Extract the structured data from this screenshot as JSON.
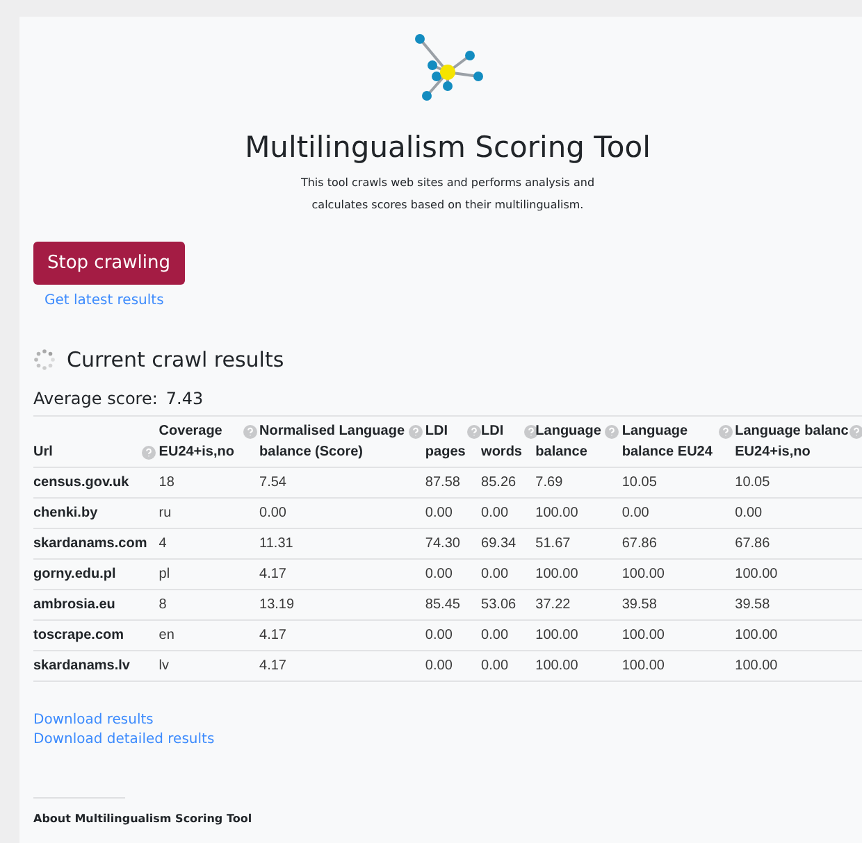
{
  "header": {
    "title": "Multilingualism Scoring Tool",
    "description_lines": [
      "This tool crawls web sites and performs analysis and",
      "calculates scores based on their multilingualism."
    ]
  },
  "stop_button": "Stop crawling",
  "latest_link": "Get latest results",
  "results": {
    "title": "Current crawl results",
    "loading": true,
    "average_label": "Average score:",
    "average_value": "7.43",
    "columns": [
      {
        "lines": [
          "Url"
        ]
      },
      {
        "lines": [
          "Coverage",
          "EU24+is,no"
        ]
      },
      {
        "lines": [
          "Normalised Language",
          "balance (Score)"
        ]
      },
      {
        "lines": [
          "LDI",
          "pages"
        ]
      },
      {
        "lines": [
          "LDI",
          "words"
        ]
      },
      {
        "lines": [
          "Language",
          "balance"
        ]
      },
      {
        "lines": [
          "Language",
          "balance EU24"
        ]
      },
      {
        "lines": [
          "Language balanc",
          "EU24+is,no"
        ]
      }
    ],
    "rows": [
      [
        "census.gov.uk",
        "18",
        "7.54",
        "87.58",
        "85.26",
        "7.69",
        "10.05",
        "10.05"
      ],
      [
        "chenki.by",
        "ru",
        "0.00",
        "0.00",
        "0.00",
        "100.00",
        "0.00",
        "0.00"
      ],
      [
        "skardanams.com",
        "4",
        "11.31",
        "74.30",
        "69.34",
        "51.67",
        "67.86",
        "67.86"
      ],
      [
        "gorny.edu.pl",
        "pl",
        "4.17",
        "0.00",
        "0.00",
        "100.00",
        "100.00",
        "100.00"
      ],
      [
        "ambrosia.eu",
        "8",
        "13.19",
        "85.45",
        "53.06",
        "37.22",
        "39.58",
        "39.58"
      ],
      [
        "toscrape.com",
        "en",
        "4.17",
        "0.00",
        "0.00",
        "100.00",
        "100.00",
        "100.00"
      ],
      [
        "skardanams.lv",
        "lv",
        "4.17",
        "0.00",
        "0.00",
        "100.00",
        "100.00",
        "100.00"
      ]
    ]
  },
  "download_links": [
    "Download results",
    "Download detailed results"
  ],
  "footer": {
    "title": "About Multilingualism Scoring Tool"
  }
}
